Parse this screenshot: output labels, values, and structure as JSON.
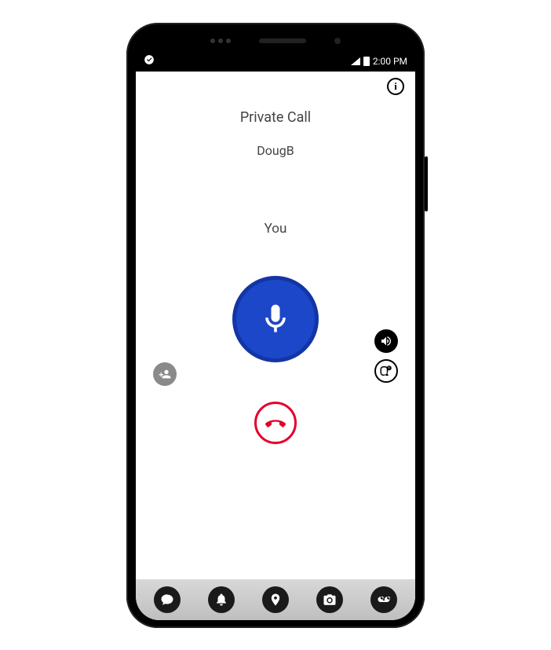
{
  "status": {
    "time": "2:00 PM"
  },
  "call": {
    "type_label": "Private Call",
    "remote_name": "DougB",
    "local_label": "You"
  },
  "icons": {
    "info": "i",
    "ptt": "microphone-icon",
    "add_person": "add-person-icon",
    "speaker": "speaker-icon",
    "record": "record-call-icon",
    "hangup": "hangup-icon"
  },
  "nav": {
    "messages": "chat-bubble-icon",
    "alerts": "bell-icon",
    "map": "location-pin-icon",
    "camera": "camera-icon",
    "voicemail": "voicemail-icon"
  },
  "colors": {
    "ptt_bg": "#1c47c9",
    "hangup": "#e4002b"
  }
}
